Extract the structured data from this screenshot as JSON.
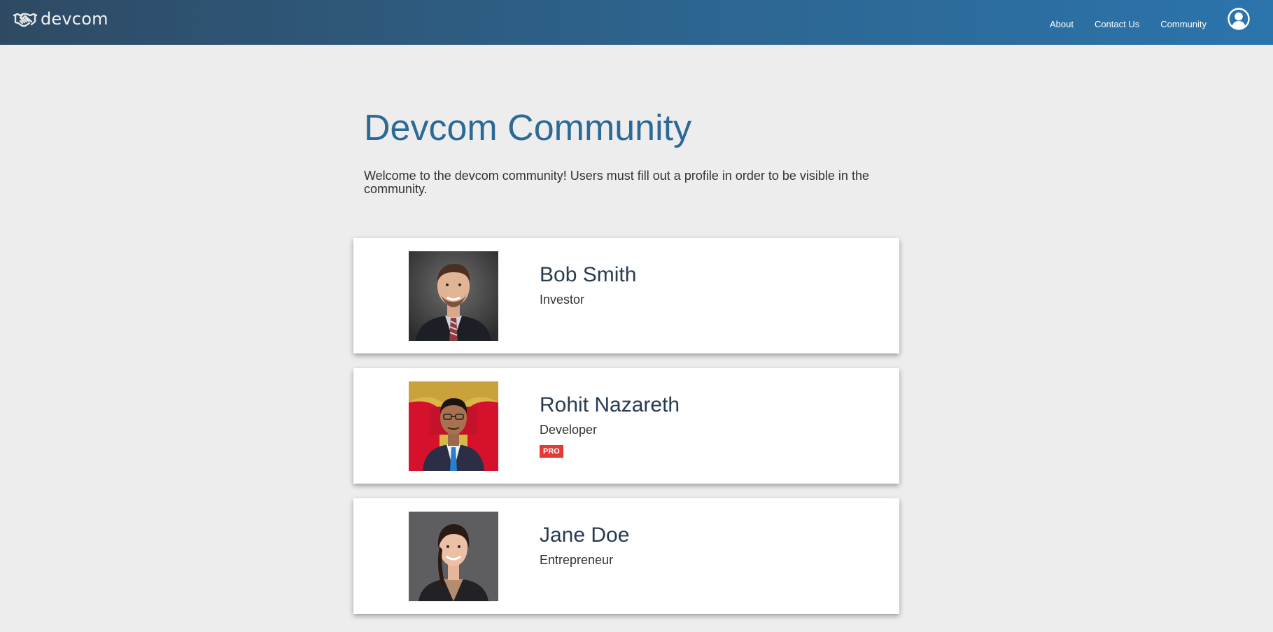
{
  "navbar": {
    "brand": "devcom",
    "links": [
      "About",
      "Contact Us",
      "Community"
    ]
  },
  "page": {
    "title": "Devcom Community",
    "lead": "Welcome to the devcom community! Users must fill out a profile in order to be visible in the community."
  },
  "profiles": [
    {
      "name": "Bob Smith",
      "role": "Investor",
      "badge": ""
    },
    {
      "name": "Rohit Nazareth",
      "role": "Developer",
      "badge": "PRO"
    },
    {
      "name": "Jane Doe",
      "role": "Entrepreneur",
      "badge": ""
    }
  ],
  "colors": {
    "navbar_start": "#2e4a63",
    "navbar_end": "#2b74ac",
    "title": "#2c6a96",
    "name": "#283c50",
    "badge": "#e53935",
    "background": "#ededed"
  },
  "icons": {
    "brand": "handshake-icon",
    "account": "user-circle-icon"
  }
}
